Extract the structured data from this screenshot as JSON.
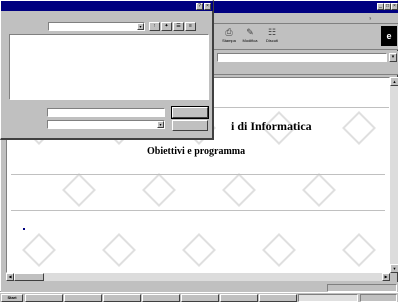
{
  "browser": {
    "title": "",
    "menu": {
      "help": "?"
    },
    "toolbar": {
      "print": "Stampa",
      "edit": "Modifica",
      "discuss": "Discuti"
    },
    "address": {
      "value": ""
    },
    "links": [
      "",
      "",
      ""
    ],
    "content": {
      "breadcrumb": "",
      "heading": "i di Informatica",
      "subheading": "Obiettivi e programma",
      "section_label": "",
      "bullets": [
        "",
        "",
        ""
      ]
    },
    "status": {
      "left": "",
      "zone": ""
    }
  },
  "dialog": {
    "title": "",
    "look_in_label": "",
    "look_in_value": "",
    "file_name_label": "",
    "file_name_value": "",
    "file_type_label": "",
    "file_type_value": "",
    "save_label": "",
    "cancel_label": ""
  },
  "taskbar": {
    "start": "Start",
    "tasks": [
      "",
      "",
      "",
      "",
      "",
      "",
      "",
      ""
    ],
    "clock": ""
  }
}
